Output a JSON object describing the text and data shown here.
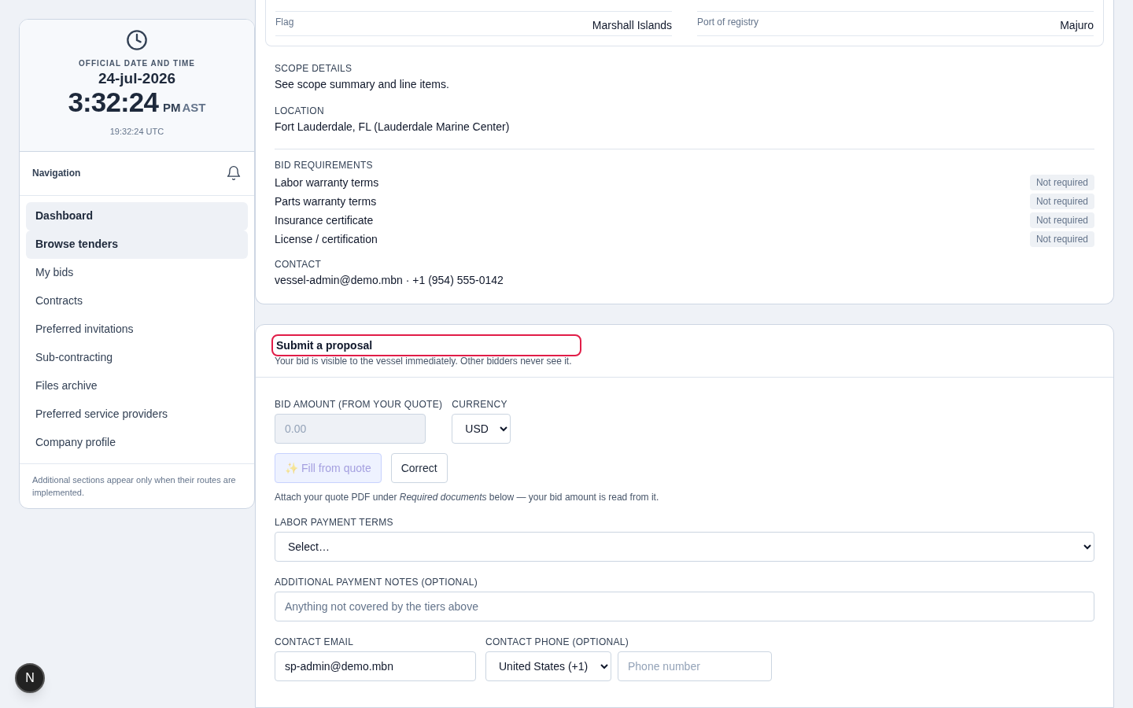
{
  "clock": {
    "label": "OFFICIAL DATE AND TIME",
    "date": "24-jul-2026",
    "time": "3:32:24",
    "meridiem": "PM",
    "zone": "AST",
    "utc": "19:32:24 UTC"
  },
  "navigation": {
    "title": "Navigation",
    "items": [
      {
        "label": "Dashboard",
        "selected": true
      },
      {
        "label": "Browse tenders",
        "selected": true
      },
      {
        "label": "My bids",
        "selected": false
      },
      {
        "label": "Contracts",
        "selected": false
      },
      {
        "label": "Preferred invitations",
        "selected": false
      },
      {
        "label": "Sub-contracting",
        "selected": false
      },
      {
        "label": "Files archive",
        "selected": false
      },
      {
        "label": "Preferred service providers",
        "selected": false
      },
      {
        "label": "Company profile",
        "selected": false
      }
    ],
    "note": "Additional sections appear only when their routes are implemented."
  },
  "vessel_details": [
    {
      "label": "Flag",
      "value": "Marshall Islands"
    },
    {
      "label": "Port of registry",
      "value": "Majuro"
    }
  ],
  "scope": {
    "label": "SCOPE DETAILS",
    "value": "See scope summary and line items."
  },
  "location": {
    "label": "LOCATION",
    "value": "Fort Lauderdale, FL (Lauderdale Marine Center)"
  },
  "bid_requirements": {
    "label": "BID REQUIREMENTS",
    "items": [
      {
        "name": "Labor warranty terms",
        "status": "Not required"
      },
      {
        "name": "Parts warranty terms",
        "status": "Not required"
      },
      {
        "name": "Insurance certificate",
        "status": "Not required"
      },
      {
        "name": "License / certification",
        "status": "Not required"
      }
    ]
  },
  "contact": {
    "label": "CONTACT",
    "value": "vessel-admin@demo.mbn · +1 (954) 555-0142"
  },
  "proposal": {
    "title": "Submit a proposal",
    "focused": true,
    "subtitle": "Your bid is visible to the vessel immediately. Other bidders never see it.",
    "bid_amount": {
      "label": "BID AMOUNT (FROM YOUR QUOTE)",
      "placeholder": "0.00",
      "disabled": true
    },
    "currency": {
      "label": "CURRENCY",
      "value": "USD"
    },
    "fill_button": {
      "icon": "✨",
      "label": "Fill from quote",
      "disabled": true
    },
    "correct_button": {
      "label": "Correct"
    },
    "hint": "Attach your quote PDF under *Required documents* below — your bid amount is read from it.",
    "labor_terms": {
      "label": "LABOR PAYMENT TERMS",
      "value": "Select…"
    },
    "notes": {
      "label": "ADDITIONAL PAYMENT NOTES (OPTIONAL)",
      "placeholder": "Anything not covered by the tiers above"
    },
    "email": {
      "label": "CONTACT EMAIL",
      "value": "sp-admin@demo.mbn"
    },
    "phone": {
      "label": "CONTACT PHONE (OPTIONAL)",
      "country": "United States (+1)",
      "placeholder": "Phone number"
    }
  },
  "dev_badge": "N"
}
